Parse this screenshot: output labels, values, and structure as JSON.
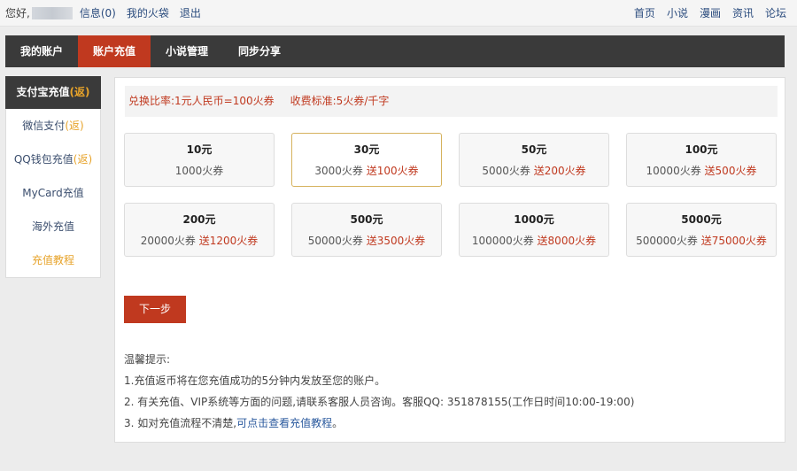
{
  "topbar": {
    "greeting": "您好,",
    "messages": "信息(0)",
    "my_bag": "我的火袋",
    "logout": "退出",
    "right_links": [
      "首页",
      "小说",
      "漫画",
      "资讯",
      "论坛"
    ]
  },
  "nav": {
    "tabs": [
      "我的账户",
      "账户充值",
      "小说管理",
      "同步分享"
    ],
    "active_index": 1
  },
  "sidebar": {
    "items": [
      {
        "label": "支付宝充值",
        "suffix": "(返)"
      },
      {
        "label": "微信支付",
        "suffix": "(返)"
      },
      {
        "label": "QQ钱包充值",
        "suffix": "(返)"
      },
      {
        "label": "MyCard充值",
        "suffix": ""
      },
      {
        "label": "海外充值",
        "suffix": ""
      },
      {
        "label": "充值教程",
        "suffix": ""
      }
    ],
    "active_index": 0
  },
  "rate_info": {
    "ratio": "兑换比率:1元人民币=100火券",
    "standard": "收费标准:5火券/千字"
  },
  "packages": [
    {
      "amount": "10元",
      "coupons": "1000火券",
      "bonus": ""
    },
    {
      "amount": "30元",
      "coupons": "3000火券",
      "bonus": "送100火券"
    },
    {
      "amount": "50元",
      "coupons": "5000火券",
      "bonus": "送200火券"
    },
    {
      "amount": "100元",
      "coupons": "10000火券",
      "bonus": "送500火券"
    },
    {
      "amount": "200元",
      "coupons": "20000火券",
      "bonus": "送1200火券"
    },
    {
      "amount": "500元",
      "coupons": "50000火券",
      "bonus": "送3500火券"
    },
    {
      "amount": "1000元",
      "coupons": "100000火券",
      "bonus": "送8000火券"
    },
    {
      "amount": "5000元",
      "coupons": "500000火券",
      "bonus": "送75000火券"
    }
  ],
  "selected_package_index": 1,
  "next_button": "下一步",
  "tips": {
    "title": "温馨提示:",
    "line1": "1.充值返币将在您充值成功的5分钟内发放至您的账户。",
    "line2": "2. 有关充值、VIP系统等方面的问题,请联系客服人员咨询。客服QQ: 351878155(工作日时间10:00-19:00)",
    "line3_prefix": "3. 如对充值流程不清楚,",
    "line3_link": "可点击查看充值教程",
    "line3_suffix": "。"
  },
  "colors": {
    "accent_red": "#c0391f",
    "dark_nav": "#3a3a3a",
    "bonus_orange": "#e7a32a",
    "selected_border": "#d6b25d"
  }
}
